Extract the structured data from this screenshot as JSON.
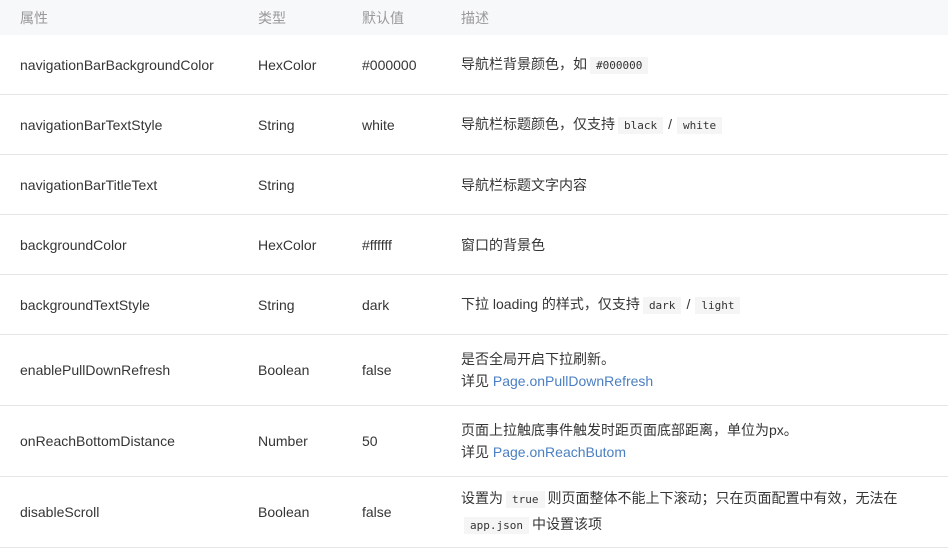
{
  "headers": [
    "属性",
    "类型",
    "默认值",
    "描述"
  ],
  "rows": [
    {
      "name": "navigationBarBackgroundColor",
      "type": "HexColor",
      "default": "#000000",
      "desc": [
        [
          {
            "t": "text",
            "v": "导航栏背景颜色，如"
          },
          {
            "t": "code",
            "v": "#000000"
          }
        ]
      ]
    },
    {
      "name": "navigationBarTextStyle",
      "type": "String",
      "default": "white",
      "desc": [
        [
          {
            "t": "text",
            "v": "导航栏标题颜色，仅支持"
          },
          {
            "t": "code",
            "v": "black"
          },
          {
            "t": "text",
            "v": "/"
          },
          {
            "t": "code",
            "v": "white"
          }
        ]
      ]
    },
    {
      "name": "navigationBarTitleText",
      "type": "String",
      "default": "",
      "desc": [
        [
          {
            "t": "text",
            "v": "导航栏标题文字内容"
          }
        ]
      ]
    },
    {
      "name": "backgroundColor",
      "type": "HexColor",
      "default": "#ffffff",
      "desc": [
        [
          {
            "t": "text",
            "v": "窗口的背景色"
          }
        ]
      ]
    },
    {
      "name": "backgroundTextStyle",
      "type": "String",
      "default": "dark",
      "desc": [
        [
          {
            "t": "text",
            "v": "下拉 loading 的样式，仅支持"
          },
          {
            "t": "code",
            "v": "dark"
          },
          {
            "t": "text",
            "v": "/"
          },
          {
            "t": "code",
            "v": "light"
          }
        ]
      ]
    },
    {
      "name": "enablePullDownRefresh",
      "type": "Boolean",
      "default": "false",
      "desc": [
        [
          {
            "t": "text",
            "v": "是否全局开启下拉刷新。"
          }
        ],
        [
          {
            "t": "text",
            "v": "详见 "
          },
          {
            "t": "link",
            "v": "Page.onPullDownRefresh"
          }
        ]
      ]
    },
    {
      "name": "onReachBottomDistance",
      "type": "Number",
      "default": "50",
      "desc": [
        [
          {
            "t": "text",
            "v": "页面上拉触底事件触发时距页面底部距离，单位为px。"
          }
        ],
        [
          {
            "t": "text",
            "v": "详见 "
          },
          {
            "t": "link",
            "v": "Page.onReachButom"
          }
        ]
      ]
    },
    {
      "name": "disableScroll",
      "type": "Boolean",
      "default": "false",
      "desc": [
        [
          {
            "t": "text",
            "v": "设置为"
          },
          {
            "t": "code",
            "v": "true"
          },
          {
            "t": "text",
            "v": "则页面整体不能上下滚动；只在页面配置中有效，无法在"
          }
        ],
        [
          {
            "t": "code",
            "v": "app.json"
          },
          {
            "t": "text",
            "v": "中设置该项"
          }
        ]
      ]
    }
  ]
}
